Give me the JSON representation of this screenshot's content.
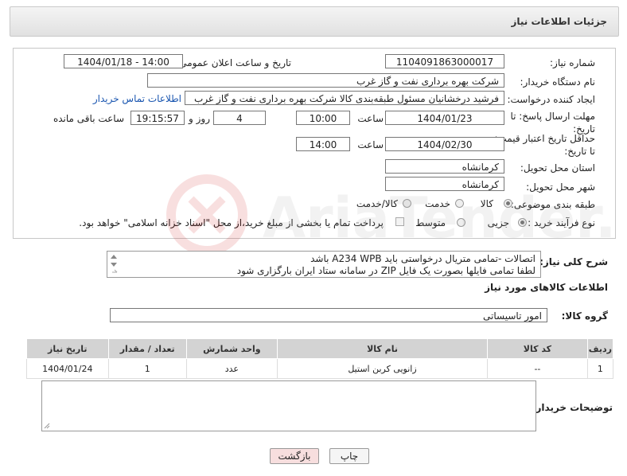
{
  "header": {
    "title": "جزئیات اطلاعات نیاز"
  },
  "form": {
    "need_number_label": "شماره نیاز:",
    "need_number": "1104091863000017",
    "announce_label": "تاریخ و ساعت اعلان عمومی:",
    "announce_value": "1404/01/18 - 14:00",
    "buyer_org_label": "نام دستگاه خریدار:",
    "buyer_org": "شرکت بهره برداری نفت و گاز غرب",
    "creator_label": "ایجاد کننده درخواست:",
    "creator": "فرشید درخشانیان مسئول طبقه‌بندی کالا شرکت بهره برداری نفت و گاز غرب",
    "contact_link": "اطلاعات تماس خریدار",
    "reply_deadline_label": "مهلت ارسال پاسخ: تا تاریخ:",
    "reply_date": "1404/01/23",
    "time_label": "ساعت",
    "reply_time": "10:00",
    "days_value": "4",
    "days_label": "روز و",
    "remaining_time": "19:15:57",
    "remaining_label": "ساعت باقی مانده",
    "price_deadline_label": "حداقل تاریخ اعتبار قیمت: تا تاریخ:",
    "price_date": "1404/02/30",
    "price_time_label": "ساعت",
    "price_time": "14:00",
    "province_label": "استان محل تحویل:",
    "province": "کرمانشاه",
    "city_label": "شهر محل تحویل:",
    "city": "کرمانشاه",
    "category_label": "طبقه بندی موضوعی:",
    "category_options": [
      "کالا",
      "خدمت",
      "کالا/خدمت"
    ],
    "category_selected": "کالا",
    "process_label": "نوع فرآیند خرید :",
    "process_options": [
      "جزیی",
      "متوسط"
    ],
    "process_selected": "جزیی",
    "payment_note": "پرداخت تمام یا بخشی از مبلغ خرید،از محل \"اسناد خزانه اسلامی\" خواهد بود."
  },
  "description": {
    "label": "شرح کلی نیاز:",
    "line1": "اتصالات -تمامی متریال درخواستی باید A234 WPB باشد",
    "line2": "لطفا تمامی فایلها بصورت یک فایل ZIP در سامانه ستاد ایران بارگزاری شود"
  },
  "goods_section": {
    "title": "اطلاعات کالاهای مورد نیاز",
    "group_label": "گروه کالا:",
    "group_value": "امور تاسیساتی"
  },
  "table": {
    "headers": [
      "ردیف",
      "کد کالا",
      "نام کالا",
      "واحد شمارش",
      "تعداد / مقدار",
      "تاریخ نیاز"
    ],
    "rows": [
      [
        "1",
        "--",
        "زانویی کربن استیل",
        "عدد",
        "1",
        "1404/01/24"
      ]
    ]
  },
  "buyer_notes": {
    "label": "توضیحات خریدار:",
    "value": ""
  },
  "buttons": {
    "print": "چاپ",
    "back": "بازگشت"
  },
  "colors": {
    "link": "#1a56b0",
    "back_button_bg": "#f7dede",
    "table_header": "#d3d3d3"
  }
}
